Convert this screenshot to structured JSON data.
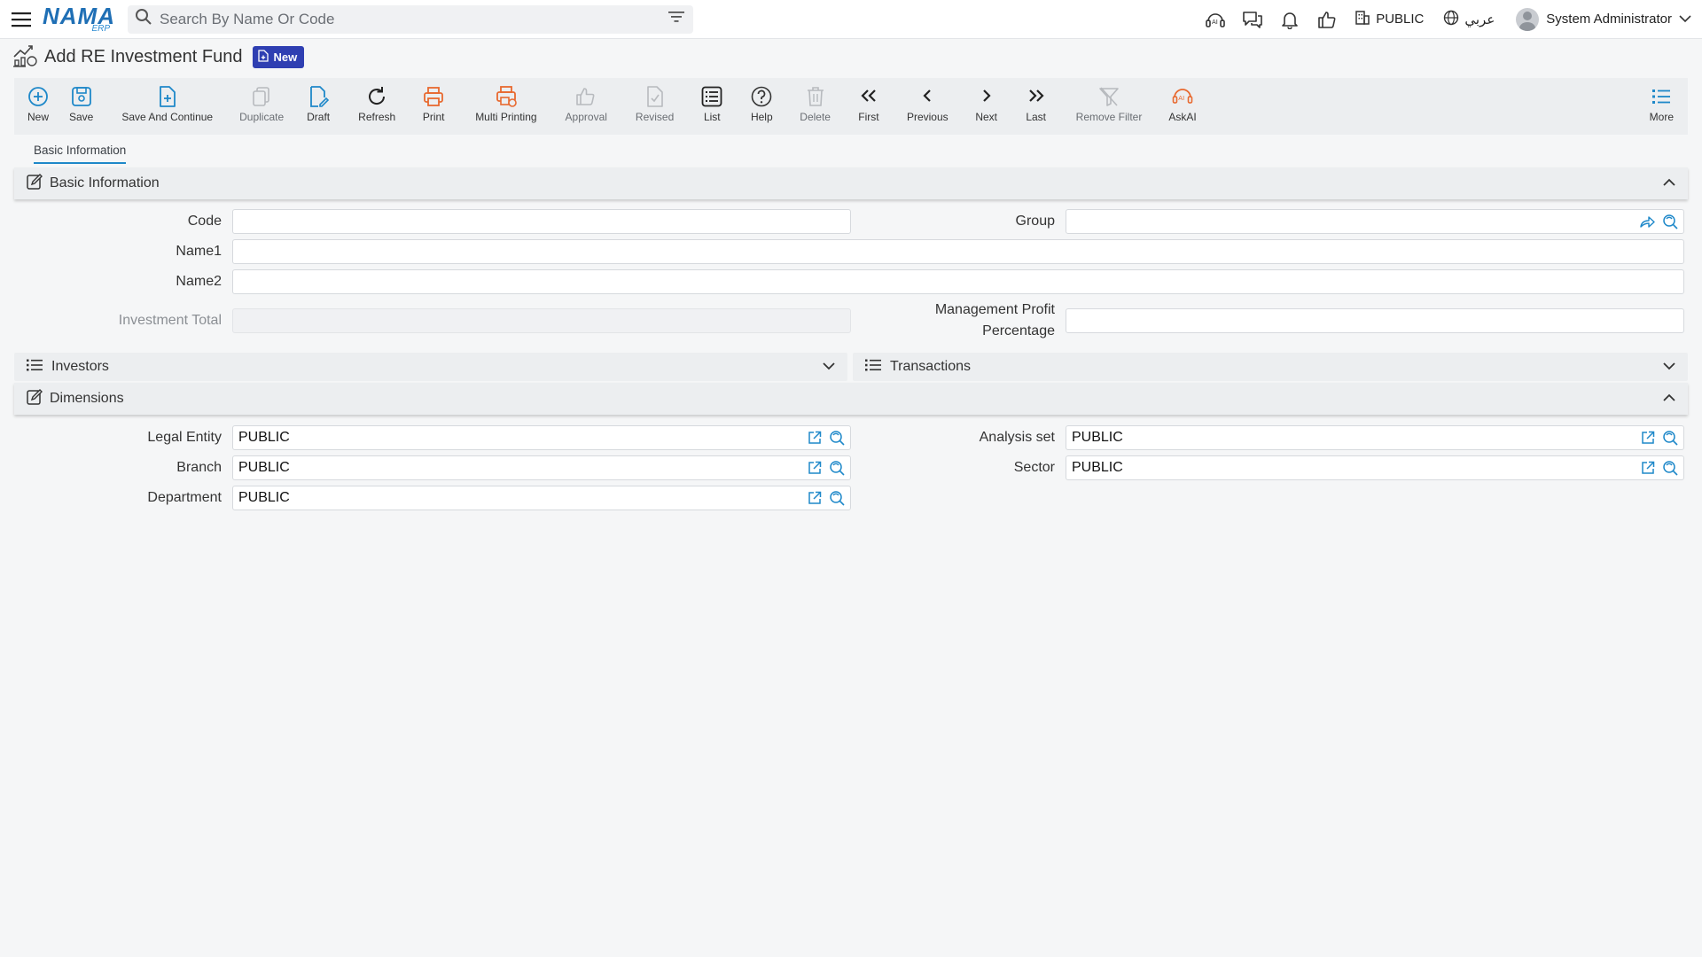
{
  "header": {
    "logo_text": "NAMA",
    "logo_sub": "ERP",
    "search_placeholder": "Search By Name Or Code",
    "company": "PUBLIC",
    "language": "عربي",
    "user": "System Administrator"
  },
  "page": {
    "title": "Add RE Investment Fund",
    "badge": "New"
  },
  "toolbar": {
    "new": "New",
    "save": "Save",
    "save_continue": "Save And Continue",
    "duplicate": "Duplicate",
    "draft": "Draft",
    "refresh": "Refresh",
    "print": "Print",
    "multi_printing": "Multi Printing",
    "approval": "Approval",
    "revised": "Revised",
    "list": "List",
    "help": "Help",
    "delete": "Delete",
    "first": "First",
    "previous": "Previous",
    "next": "Next",
    "last": "Last",
    "remove_filter": "Remove Filter",
    "askai": "AskAI",
    "more": "More"
  },
  "tabs": [
    "Basic Information"
  ],
  "basic": {
    "heading": "Basic Information",
    "code_label": "Code",
    "code_value": "",
    "group_label": "Group",
    "group_value": "",
    "name1_label": "Name1",
    "name1_value": "",
    "name2_label": "Name2",
    "name2_value": "",
    "investment_total_label": "Investment Total",
    "investment_total_value": "",
    "mgmt_profit_label_1": "Management Profit",
    "mgmt_profit_label_2": "Percentage",
    "mgmt_profit_value": ""
  },
  "investors": {
    "heading": "Investors"
  },
  "transactions": {
    "heading": "Transactions"
  },
  "dimensions": {
    "heading": "Dimensions",
    "legal_entity_label": "Legal Entity",
    "legal_entity_value": "PUBLIC",
    "analysis_set_label": "Analysis set",
    "analysis_set_value": "PUBLIC",
    "branch_label": "Branch",
    "branch_value": "PUBLIC",
    "sector_label": "Sector",
    "sector_value": "PUBLIC",
    "department_label": "Department",
    "department_value": "PUBLIC"
  },
  "colors": {
    "accent": "#1e88c9",
    "print_orange": "#e8692f",
    "badge": "#2f3fb2"
  }
}
